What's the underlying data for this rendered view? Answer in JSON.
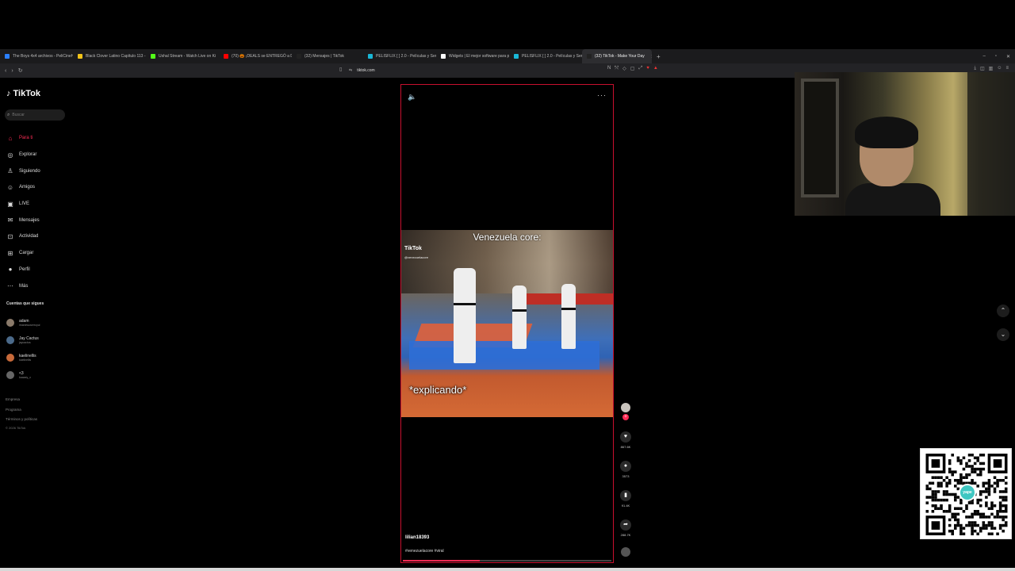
{
  "browser": {
    "tabs": [
      {
        "label": "The Boys 4x4 archivos - PeliCineHD",
        "color": "#2a7fff"
      },
      {
        "label": "Black Clover Latino Capítulo 113 - V",
        "color": "#f2c318"
      },
      {
        "label": "Ushal Stream - Watch Live on Ki",
        "color": "#53fc18"
      },
      {
        "label": "(70) 🎃 ¡DEALS se ENTREGÓ a DIO!",
        "color": "#ff0000"
      },
      {
        "label": "(32) Mensajes | TikTok",
        "color": "#222222"
      },
      {
        "label": "PELISFLIX [ ] 2.0 - Películas y Ser",
        "color": "#19b7d6"
      },
      {
        "label": "Widgets | El mejor software para po",
        "color": "#ffffff"
      },
      {
        "label": "PELISFLIX [ ] 2.0 - Películas y Ser",
        "color": "#19b7d6"
      },
      {
        "label": "(32) TikTok - Make Your Day",
        "color": "#222222",
        "active": true
      }
    ],
    "new_tab": "+",
    "window_controls": {
      "minimize": "–",
      "maximize": "▫",
      "close": "✕"
    },
    "address": "tiktok.com"
  },
  "sidebar": {
    "logo": "TikTok",
    "search_placeholder": "Buscar",
    "menu": [
      {
        "label": "Para ti",
        "icon": "home-icon",
        "glyph": "⌂",
        "active": true
      },
      {
        "label": "Explorar",
        "icon": "compass-icon",
        "glyph": "◎"
      },
      {
        "label": "Siguiendo",
        "icon": "following-icon",
        "glyph": "♙"
      },
      {
        "label": "Amigos",
        "icon": "friends-icon",
        "glyph": "☺"
      },
      {
        "label": "LIVE",
        "icon": "live-icon",
        "glyph": "▣"
      },
      {
        "label": "Mensajes",
        "icon": "messages-icon",
        "glyph": "✉"
      },
      {
        "label": "Actividad",
        "icon": "activity-icon",
        "glyph": "⊡"
      },
      {
        "label": "Cargar",
        "icon": "upload-icon",
        "glyph": "⊞"
      },
      {
        "label": "Perfil",
        "icon": "profile-icon",
        "glyph": "●"
      },
      {
        "label": "Más",
        "icon": "more-icon",
        "glyph": "⋯"
      }
    ],
    "following_title": "Cuentas que sigues",
    "following": [
      {
        "name": "adam",
        "handle": "imanewuserrcpul",
        "color": "#8a7a6a"
      },
      {
        "name": "Jay Cactus",
        "handle": "jaycactus",
        "color": "#4b6a8a"
      },
      {
        "name": "kaelinellis",
        "handle": "kaelinellis",
        "color": "#c86a3a"
      },
      {
        "name": "<3",
        "handle": "kaaaey_x",
        "color": "#666666"
      }
    ],
    "footer": [
      "Empresa",
      "Programa",
      "Términos y políticas"
    ],
    "copyright": "© 2026 TikTok"
  },
  "video": {
    "overlay_top": "Venezuela core:",
    "watermark": "TikTok",
    "watermark_handle": "@venezuelacore",
    "overlay_bottom": "*explicando*",
    "username": "lilian18393",
    "hashtags": "#venezuelacore #viral",
    "progress": 0.37
  },
  "actions": {
    "likes": "867.6K",
    "comments": "3573",
    "saves": "91.4K",
    "shares": "288.7K"
  },
  "qr_badge": "yape"
}
